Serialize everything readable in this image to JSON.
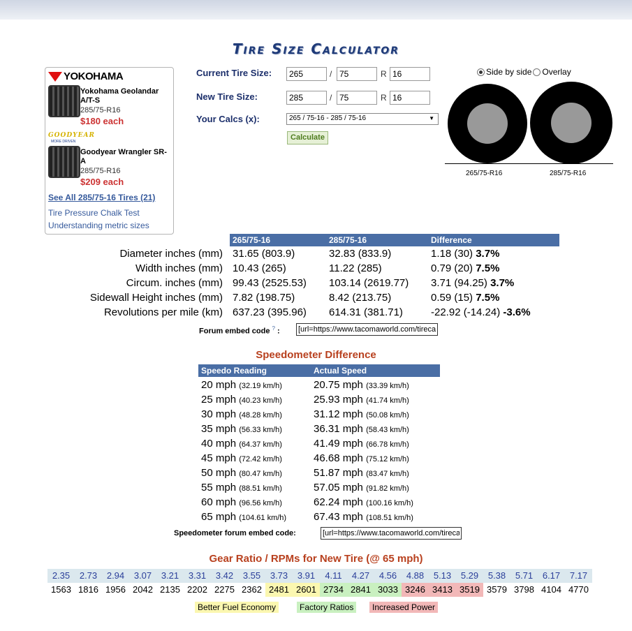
{
  "page": {
    "title": "Tire Size Calculator"
  },
  "ads": {
    "brand1": "YOKOHAMA",
    "tire1": {
      "name": "Yokohama Geolandar A/T-S",
      "size": "285/75-R16",
      "price": "$180 each"
    },
    "brand2": "GOODYEAR",
    "brand2_sub": "MORE DRIVEN",
    "tire2": {
      "name": "Goodyear Wrangler SR-A",
      "size": "285/75-R16",
      "price": "$209 each"
    },
    "see_all": "See All 285/75-16 Tires (21)",
    "links": [
      "Tire Pressure Chalk Test",
      "Understanding metric sizes"
    ]
  },
  "form": {
    "current_label": "Current Tire Size:",
    "new_label": "New Tire Size:",
    "calcs_label": "Your Calcs (x):",
    "sep_slash": "/",
    "sep_r": "R",
    "current": {
      "width": "265",
      "aspect": "75",
      "rim": "16"
    },
    "new": {
      "width": "285",
      "aspect": "75",
      "rim": "16"
    },
    "calcs_selected": "265 / 75-16 - 285 / 75-16",
    "calculate": "Calculate"
  },
  "viz": {
    "opt_side": "Side by side",
    "opt_overlay": "Overlay",
    "label1": "265/75-R16",
    "label2": "285/75-R16"
  },
  "compare": {
    "headers": [
      "265/75-16",
      "285/75-16",
      "Difference"
    ],
    "rows": [
      {
        "label": "Diameter inches (mm)",
        "a": "31.65 (803.9)",
        "b": "32.83 (833.9)",
        "diff": "1.18 (30)",
        "pct": "3.7%"
      },
      {
        "label": "Width inches (mm)",
        "a": "10.43 (265)",
        "b": "11.22 (285)",
        "diff": "0.79 (20)",
        "pct": "7.5%"
      },
      {
        "label": "Circum. inches (mm)",
        "a": "99.43 (2525.53)",
        "b": "103.14 (2619.77)",
        "diff": "3.71 (94.25)",
        "pct": "3.7%"
      },
      {
        "label": "Sidewall Height inches (mm)",
        "a": "7.82 (198.75)",
        "b": "8.42 (213.75)",
        "diff": "0.59 (15)",
        "pct": "7.5%"
      },
      {
        "label": "Revolutions per mile (km)",
        "a": "637.23 (395.96)",
        "b": "614.31 (381.71)",
        "diff": "-22.92 (-14.24)",
        "pct": "-3.6%"
      }
    ],
    "embed_label": "Forum embed code",
    "embed_help": "?",
    "embed_colon": ":",
    "embed_value": "[url=https://www.tacomaworld.com/tirecalc"
  },
  "speedo": {
    "title": "Speedometer Difference",
    "headers": [
      "Speedo Reading",
      "Actual Speed"
    ],
    "rows": [
      {
        "r": "20 mph",
        "rk": "(32.19 km/h)",
        "a": "20.75 mph",
        "ak": "(33.39 km/h)"
      },
      {
        "r": "25 mph",
        "rk": "(40.23 km/h)",
        "a": "25.93 mph",
        "ak": "(41.74 km/h)"
      },
      {
        "r": "30 mph",
        "rk": "(48.28 km/h)",
        "a": "31.12 mph",
        "ak": "(50.08 km/h)"
      },
      {
        "r": "35 mph",
        "rk": "(56.33 km/h)",
        "a": "36.31 mph",
        "ak": "(58.43 km/h)"
      },
      {
        "r": "40 mph",
        "rk": "(64.37 km/h)",
        "a": "41.49 mph",
        "ak": "(66.78 km/h)"
      },
      {
        "r": "45 mph",
        "rk": "(72.42 km/h)",
        "a": "46.68 mph",
        "ak": "(75.12 km/h)"
      },
      {
        "r": "50 mph",
        "rk": "(80.47 km/h)",
        "a": "51.87 mph",
        "ak": "(83.47 km/h)"
      },
      {
        "r": "55 mph",
        "rk": "(88.51 km/h)",
        "a": "57.05 mph",
        "ak": "(91.82 km/h)"
      },
      {
        "r": "60 mph",
        "rk": "(96.56 km/h)",
        "a": "62.24 mph",
        "ak": "(100.16 km/h)"
      },
      {
        "r": "65 mph",
        "rk": "(104.61 km/h)",
        "a": "67.43 mph",
        "ak": "(108.51 km/h)"
      }
    ],
    "embed_label": "Speedometer forum embed code:",
    "embed_value": "[url=https://www.tacomaworld.com/tirecalc"
  },
  "gear": {
    "title": "Gear Ratio / RPMs for New Tire (@ 65 mph)",
    "ratios": [
      "2.35",
      "2.73",
      "2.94",
      "3.07",
      "3.21",
      "3.31",
      "3.42",
      "3.55",
      "3.73",
      "3.91",
      "4.11",
      "4.27",
      "4.56",
      "4.88",
      "5.13",
      "5.29",
      "5.38",
      "5.71",
      "6.17",
      "7.17"
    ],
    "rpms": [
      "1563",
      "1816",
      "1956",
      "2042",
      "2135",
      "2202",
      "2275",
      "2362",
      "2481",
      "2601",
      "2734",
      "2841",
      "3033",
      "3246",
      "3413",
      "3519",
      "3579",
      "3798",
      "4104",
      "4770"
    ],
    "rpm_zones": [
      "none",
      "none",
      "none",
      "none",
      "none",
      "none",
      "none",
      "none",
      "economy",
      "economy",
      "factory",
      "factory",
      "factory",
      "power",
      "power",
      "power",
      "none",
      "none",
      "none",
      "none"
    ],
    "legend": [
      "Better Fuel Economy",
      "Factory Ratios",
      "Increased Power"
    ],
    "colors": {
      "economy": "#fbf7b0",
      "factory": "#c9f0c0",
      "power": "#f2b8b8",
      "header": "#4a6ea5"
    }
  }
}
